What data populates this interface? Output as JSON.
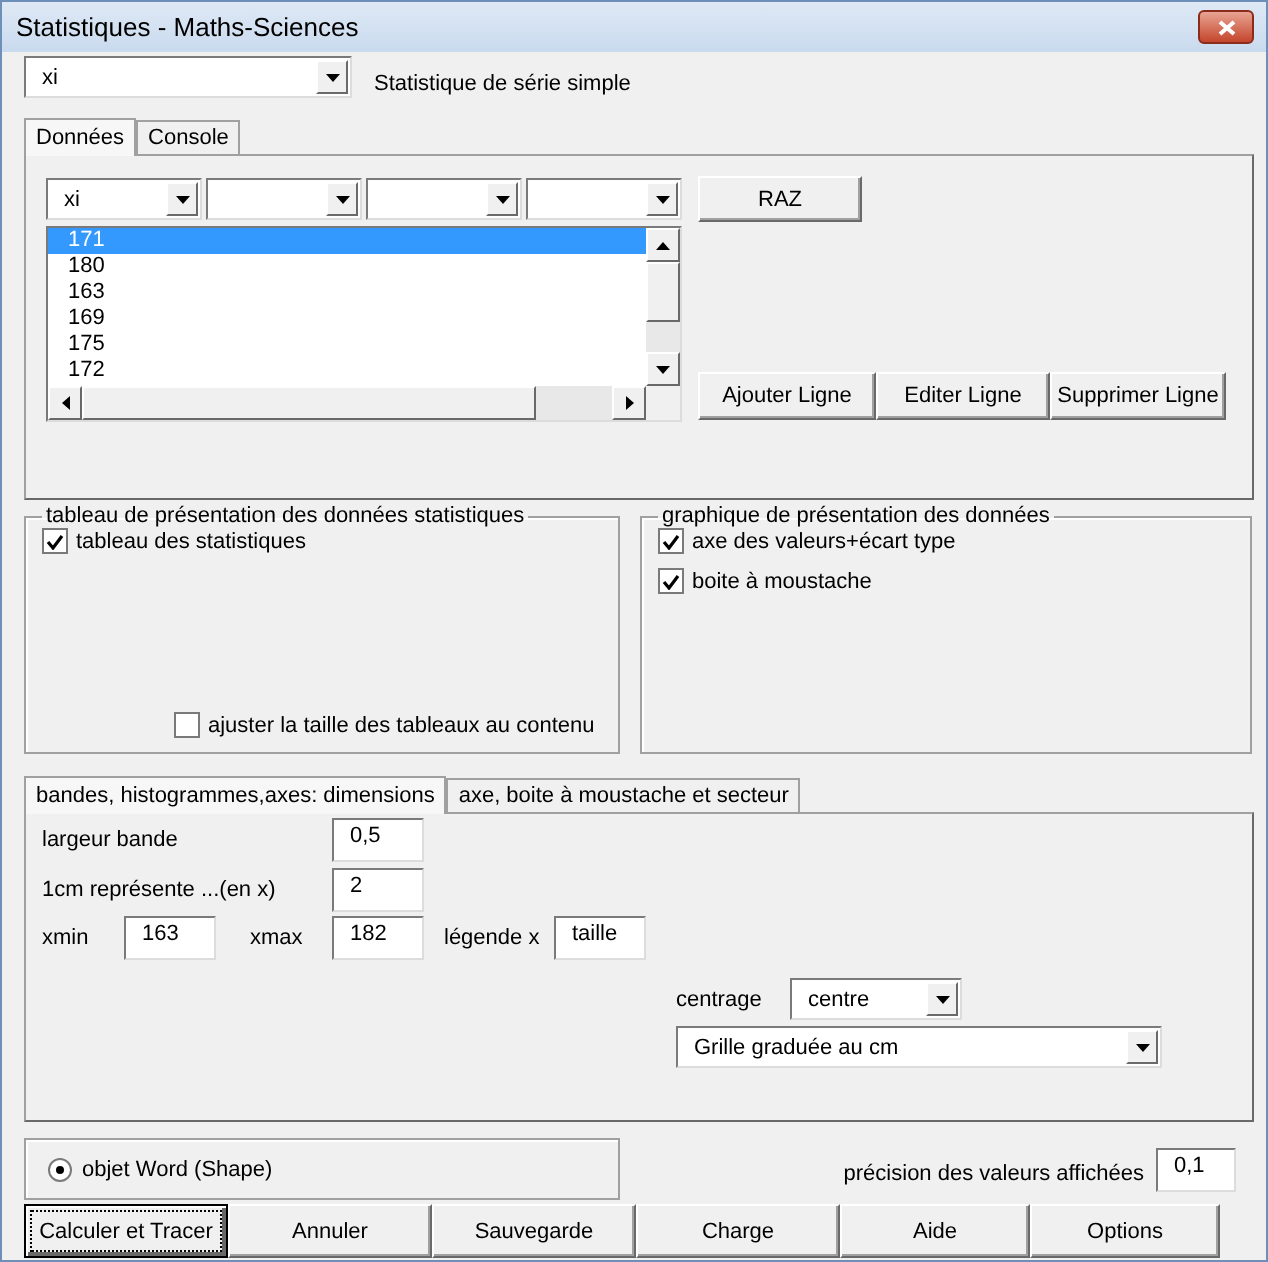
{
  "window": {
    "title": "Statistiques - Maths-Sciences"
  },
  "series_selector": {
    "value": "xi"
  },
  "series_label": "Statistique de série simple",
  "tabs": [
    {
      "label": "Données",
      "selected": true
    },
    {
      "label": "Console",
      "selected": false
    }
  ],
  "column_selectors": [
    {
      "kind": "dropdown",
      "value": "xi"
    },
    {
      "kind": "dropdown"
    },
    {
      "kind": "dropdown"
    },
    {
      "kind": "dropdown"
    }
  ],
  "raz_button": "RAZ",
  "list": [
    {
      "text": "171",
      "selected": true
    },
    {
      "text": "180",
      "selected": false
    },
    {
      "text": "163",
      "selected": false
    },
    {
      "text": "169",
      "selected": false
    },
    {
      "text": "175",
      "selected": false
    },
    {
      "text": "172",
      "selected": false
    }
  ],
  "row_buttons": [
    "Ajouter Ligne",
    "Editer Ligne",
    "Supprimer Ligne"
  ],
  "table_frame": {
    "title": "tableau de présentation des données statistiques",
    "options": [
      {
        "label": "tableau des statistiques",
        "checked": true
      }
    ],
    "fit_option": {
      "label": "ajuster la taille des tableaux au contenu",
      "checked": false
    }
  },
  "chart_frame": {
    "title": "graphique de présentation des données",
    "options": [
      {
        "label": "axe des valeurs+écart type",
        "checked": true
      },
      {
        "label": "boite à moustache",
        "checked": true
      }
    ]
  },
  "settings_tabs": [
    {
      "label": "bandes, histogrammes,axes: dimensions",
      "selected": true
    },
    {
      "label": "axe, boite à moustache et secteur",
      "selected": false
    }
  ],
  "settings": {
    "band_width": {
      "label": "largeur bande",
      "value": "0,5"
    },
    "scale": {
      "label": "1cm représente ...(en x)",
      "value": "2"
    },
    "xmin": {
      "label": "xmin",
      "value": "163"
    },
    "xmax": {
      "label": "xmax",
      "value": "182"
    },
    "legend_x": {
      "label": "légende x",
      "value": "taille"
    },
    "centering": {
      "label": "centrage",
      "value": "centre"
    },
    "grid": {
      "value": "Grille graduée au cm"
    }
  },
  "output": {
    "label": "objet Word (Shape)",
    "selected": true
  },
  "precision": {
    "label": "précision des valeurs affichées",
    "value": "0,1"
  },
  "buttons": [
    {
      "label": "Calculer et Tracer",
      "focused": true
    },
    {
      "label": "Annuler",
      "focused": false
    },
    {
      "label": "Sauvegarde",
      "focused": false
    },
    {
      "label": "Charge",
      "focused": false
    },
    {
      "label": "Aide",
      "focused": false
    },
    {
      "label": "Options",
      "focused": false
    }
  ]
}
